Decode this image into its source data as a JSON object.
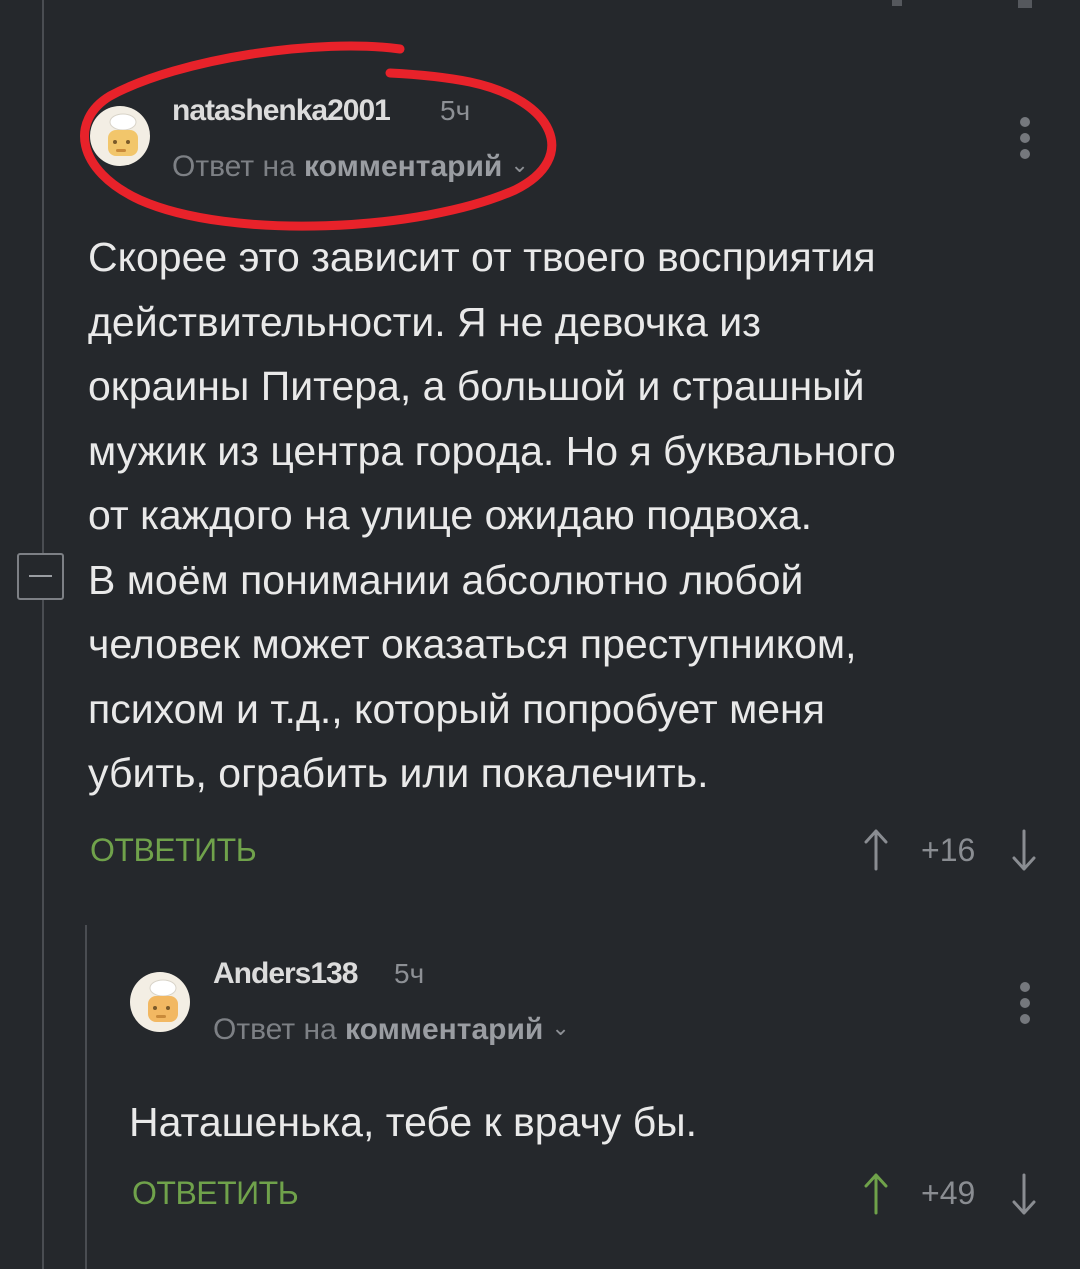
{
  "comments": [
    {
      "username": "natashenka2001",
      "time": "5ч",
      "reply_prefix": "Ответ на ",
      "reply_target": "комментарий",
      "text": "Скорее это зависит от твоего восприятия\nдействительности. Я не девочка из\nокраины Питера, а большой и страшный\nмужик из центра города. Но я буквального\nот каждого на улице ожидаю подвоха.\nВ моём понимании абсолютно любой\nчеловек может оказаться преступником,\nпсихом и т.д., который попробует меня\nубить, ограбить или покалечить.",
      "reply_label": "ОТВЕТИТЬ",
      "rating": "+16",
      "upvoted": false
    },
    {
      "username": "Anders138",
      "time": "5ч",
      "reply_prefix": "Ответ на ",
      "reply_target": "комментарий",
      "text": "Наташенька, тебе к врачу бы.",
      "reply_label": "ОТВЕТИТЬ",
      "rating": "+49",
      "upvoted": true
    }
  ],
  "colors": {
    "background": "#25282c",
    "reply_green": "#70a24b",
    "upvote_green": "#6fa24a",
    "highlight_red": "#e8222a"
  },
  "icons": [
    "avatar-chef",
    "kebab-menu-icon",
    "chevron-down-icon",
    "upvote-arrow-icon",
    "downvote-arrow-icon",
    "collapse-minus-icon"
  ]
}
